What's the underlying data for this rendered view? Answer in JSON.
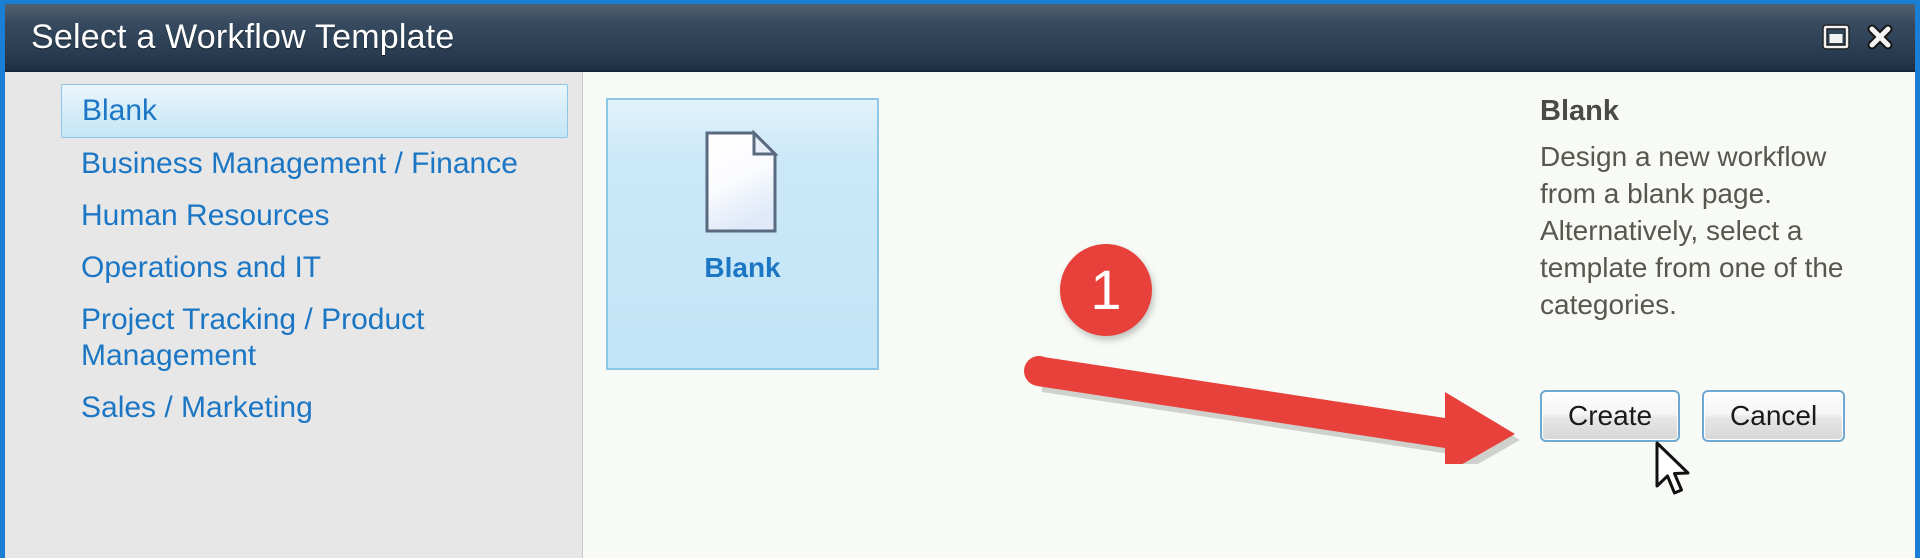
{
  "window": {
    "title": "Select a Workflow Template",
    "restore_icon": "restore-window-icon",
    "close_icon": "close-icon",
    "accent_color": "#1a7fd4",
    "titlebar_color": "#32465b"
  },
  "sidebar": {
    "items": [
      {
        "label": "Blank",
        "selected": true
      },
      {
        "label": "Business Management / Finance",
        "selected": false
      },
      {
        "label": "Human Resources",
        "selected": false
      },
      {
        "label": "Operations and IT",
        "selected": false
      },
      {
        "label": "Project Tracking / Product Management",
        "selected": false
      },
      {
        "label": "Sales / Marketing",
        "selected": false
      }
    ]
  },
  "main": {
    "templates": [
      {
        "label": "Blank",
        "icon": "blank-document-icon",
        "selected": true
      }
    ]
  },
  "description": {
    "title": "Blank",
    "body": "Design a new workflow from a blank page. Alternatively, select a template from one of the categories."
  },
  "buttons": {
    "create_label": "Create",
    "cancel_label": "Cancel"
  },
  "annotations": {
    "step_number": "1",
    "badge_color": "#e8403a",
    "arrow_color": "#e8403a",
    "cursor": "mouse-pointer"
  }
}
